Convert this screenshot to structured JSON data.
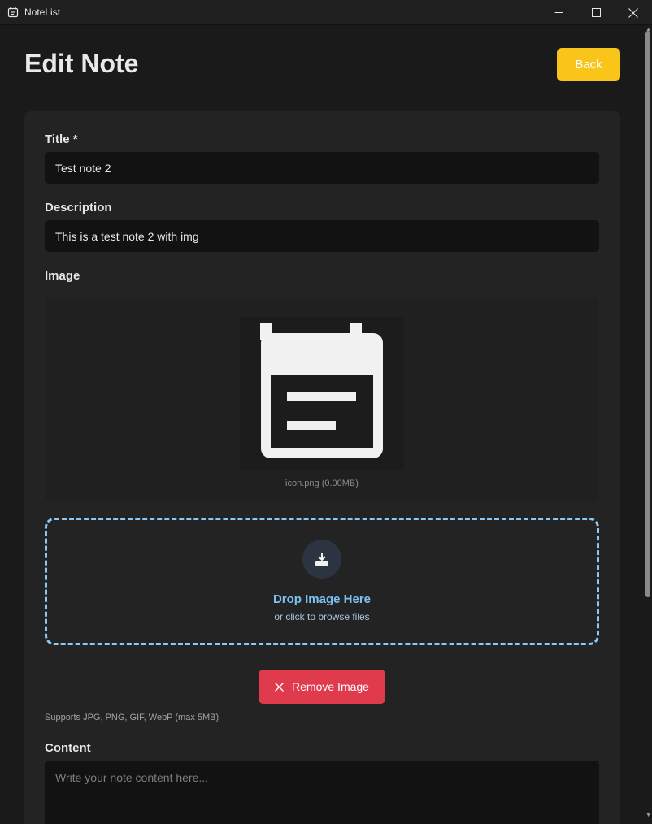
{
  "window": {
    "title": "NoteList"
  },
  "page": {
    "title": "Edit Note",
    "back_label": "Back"
  },
  "form": {
    "title_label": "Title *",
    "title_value": "Test note 2",
    "description_label": "Description",
    "description_value": "This is a test note 2 with img",
    "image_label": "Image",
    "image_caption": "icon.png (0.00MB)",
    "dropzone_title": "Drop Image Here",
    "dropzone_subtitle": "or click to browse files",
    "remove_label": "Remove Image",
    "supports_text": "Supports JPG, PNG, GIF, WebP (max 5MB)",
    "content_label": "Content",
    "content_placeholder": "Write your note content here...",
    "content_value": ""
  },
  "colors": {
    "accent": "#f9c51a",
    "danger": "#e03a4d",
    "dropzone": "#8cc8f5"
  }
}
